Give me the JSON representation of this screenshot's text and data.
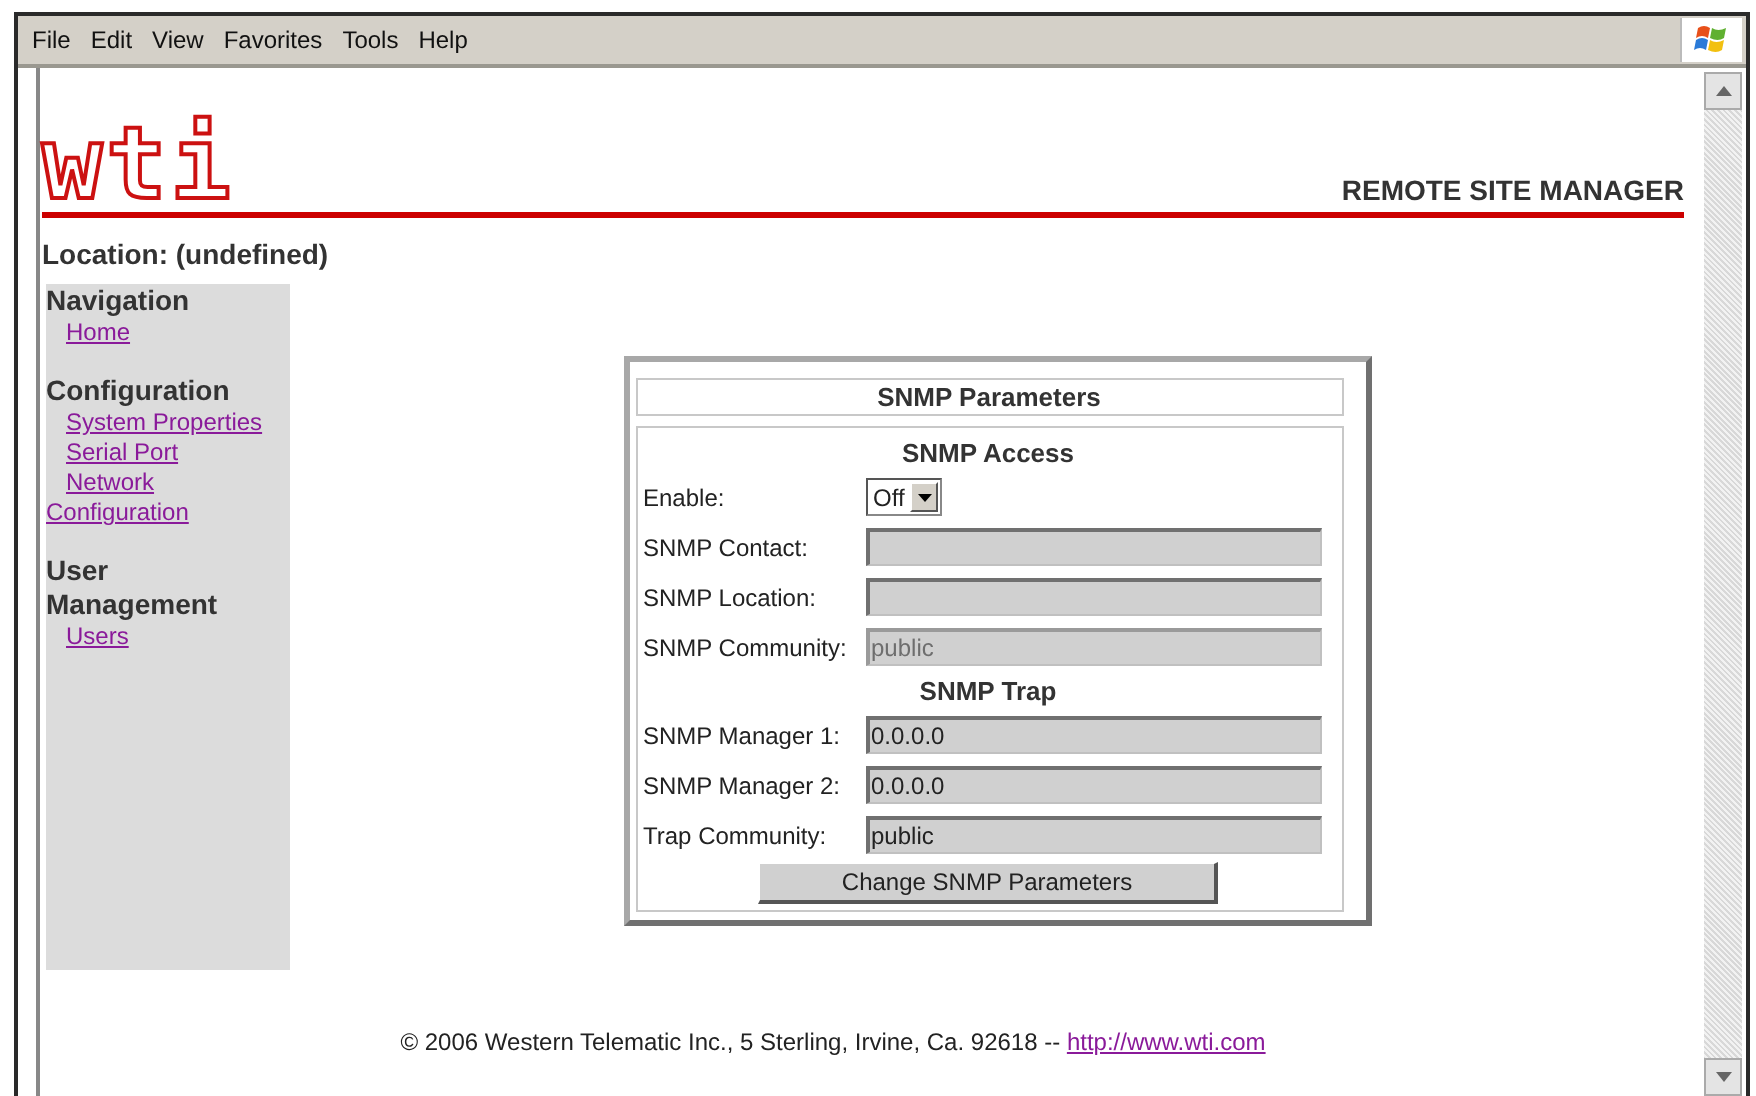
{
  "menu": [
    "File",
    "Edit",
    "View",
    "Favorites",
    "Tools",
    "Help"
  ],
  "header": {
    "logo": "wti",
    "product": "REMOTE SITE MANAGER"
  },
  "location": "Location: (undefined)",
  "sidebar": {
    "sections": [
      {
        "title": "Navigation",
        "links": [
          "Home"
        ]
      },
      {
        "title": "Configuration",
        "links": [
          "System Properties",
          "Serial Port",
          "Network Configuration"
        ]
      },
      {
        "title": "User Management",
        "links": [
          "Users"
        ]
      }
    ]
  },
  "panel": {
    "title": "SNMP Parameters",
    "sections": [
      {
        "heading": "SNMP Access",
        "rows": [
          {
            "kind": "select",
            "label": "Enable:",
            "value": "Off",
            "disabled": false
          },
          {
            "kind": "text",
            "label": "SNMP Contact:",
            "disabled": false
          },
          {
            "kind": "text",
            "label": "SNMP Location:",
            "disabled": false
          },
          {
            "kind": "text",
            "label": "SNMP Community:",
            "value": "public",
            "disabled": true
          }
        ]
      },
      {
        "heading": "SNMP Trap",
        "rows": [
          {
            "kind": "text",
            "label": "SNMP Manager 1:",
            "value": "0.0.0.0",
            "disabled": false
          },
          {
            "kind": "text",
            "label": "SNMP Manager 2:",
            "value": "0.0.0.0",
            "disabled": false
          },
          {
            "kind": "text",
            "label": "Trap Community:",
            "value": "public",
            "disabled": false
          }
        ]
      }
    ],
    "button": "Change SNMP Parameters"
  },
  "footer": {
    "text": "© 2006 Western Telematic Inc., 5 Sterling, Irvine, Ca. 92618 --",
    "link": "http://www.wti.com"
  }
}
